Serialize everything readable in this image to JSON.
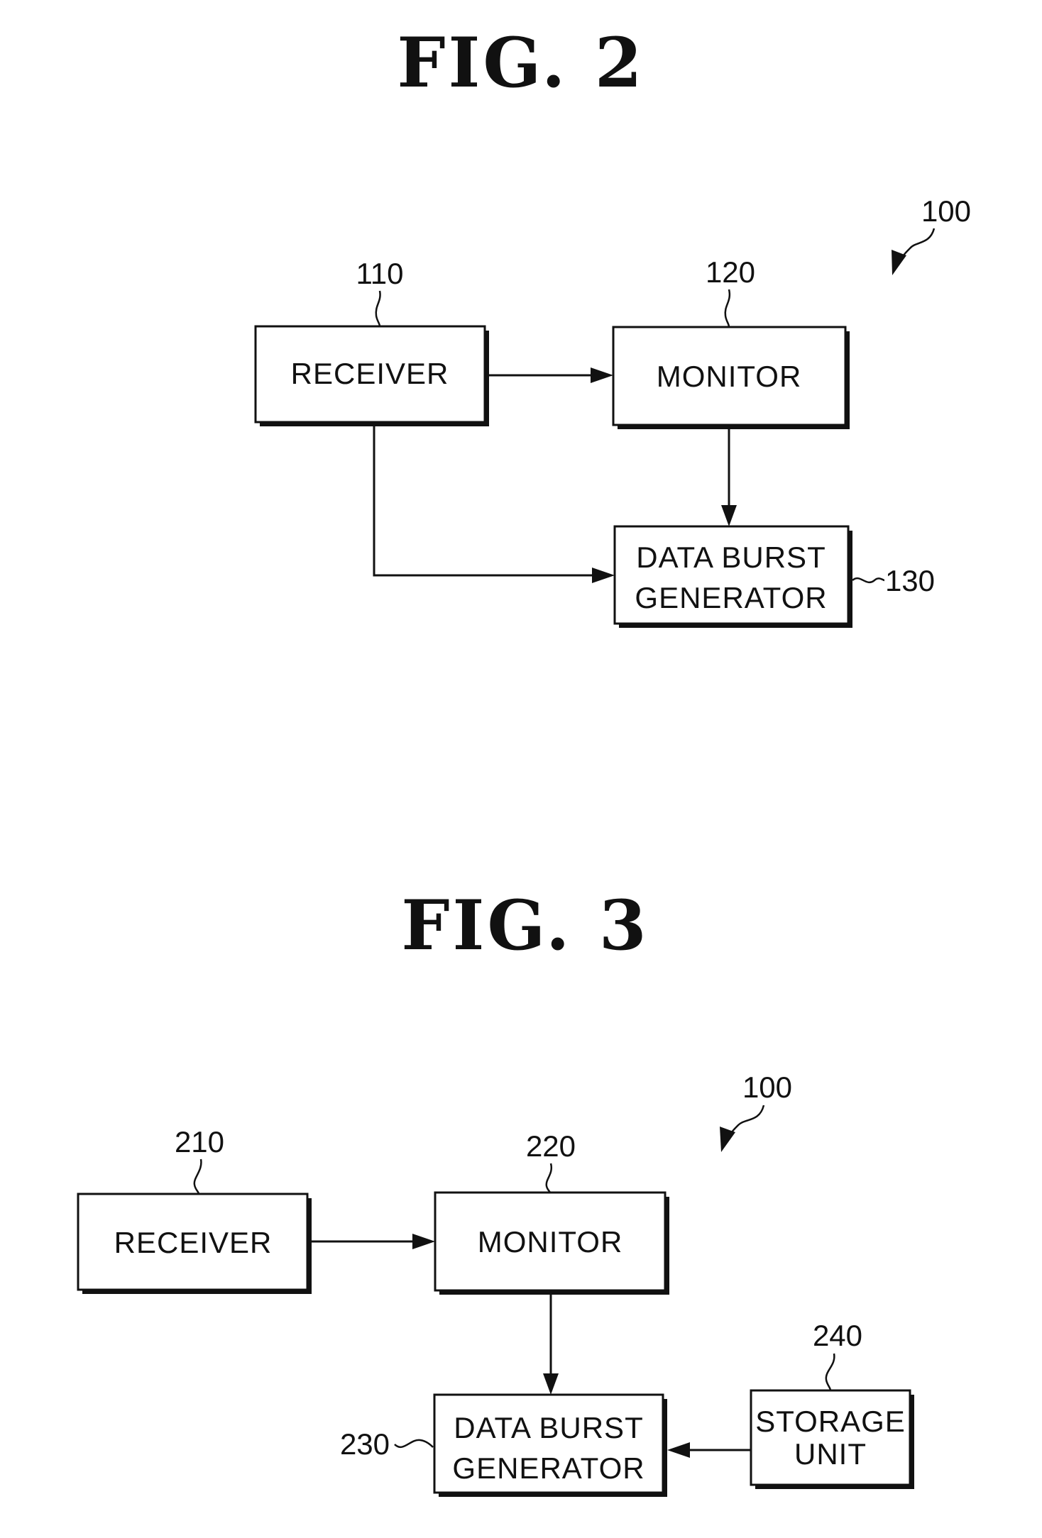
{
  "figures": [
    {
      "title": "FIG. 2",
      "system_ref": "100",
      "blocks": [
        {
          "ref": "110",
          "lines": [
            "RECEIVER"
          ]
        },
        {
          "ref": "120",
          "lines": [
            "MONITOR"
          ]
        },
        {
          "ref": "130",
          "lines": [
            "DATA BURST",
            "GENERATOR"
          ]
        }
      ],
      "connections": [
        {
          "from": "110",
          "to": "120"
        },
        {
          "from": "120",
          "to": "130"
        },
        {
          "from": "110",
          "to": "130"
        }
      ]
    },
    {
      "title": "FIG. 3",
      "system_ref": "100",
      "blocks": [
        {
          "ref": "210",
          "lines": [
            "RECEIVER"
          ]
        },
        {
          "ref": "220",
          "lines": [
            "MONITOR"
          ]
        },
        {
          "ref": "230",
          "lines": [
            "DATA BURST",
            "GENERATOR"
          ]
        },
        {
          "ref": "240",
          "lines": [
            "STORAGE",
            "UNIT"
          ]
        }
      ],
      "connections": [
        {
          "from": "210",
          "to": "220"
        },
        {
          "from": "220",
          "to": "230"
        },
        {
          "from": "240",
          "to": "230"
        }
      ]
    }
  ]
}
